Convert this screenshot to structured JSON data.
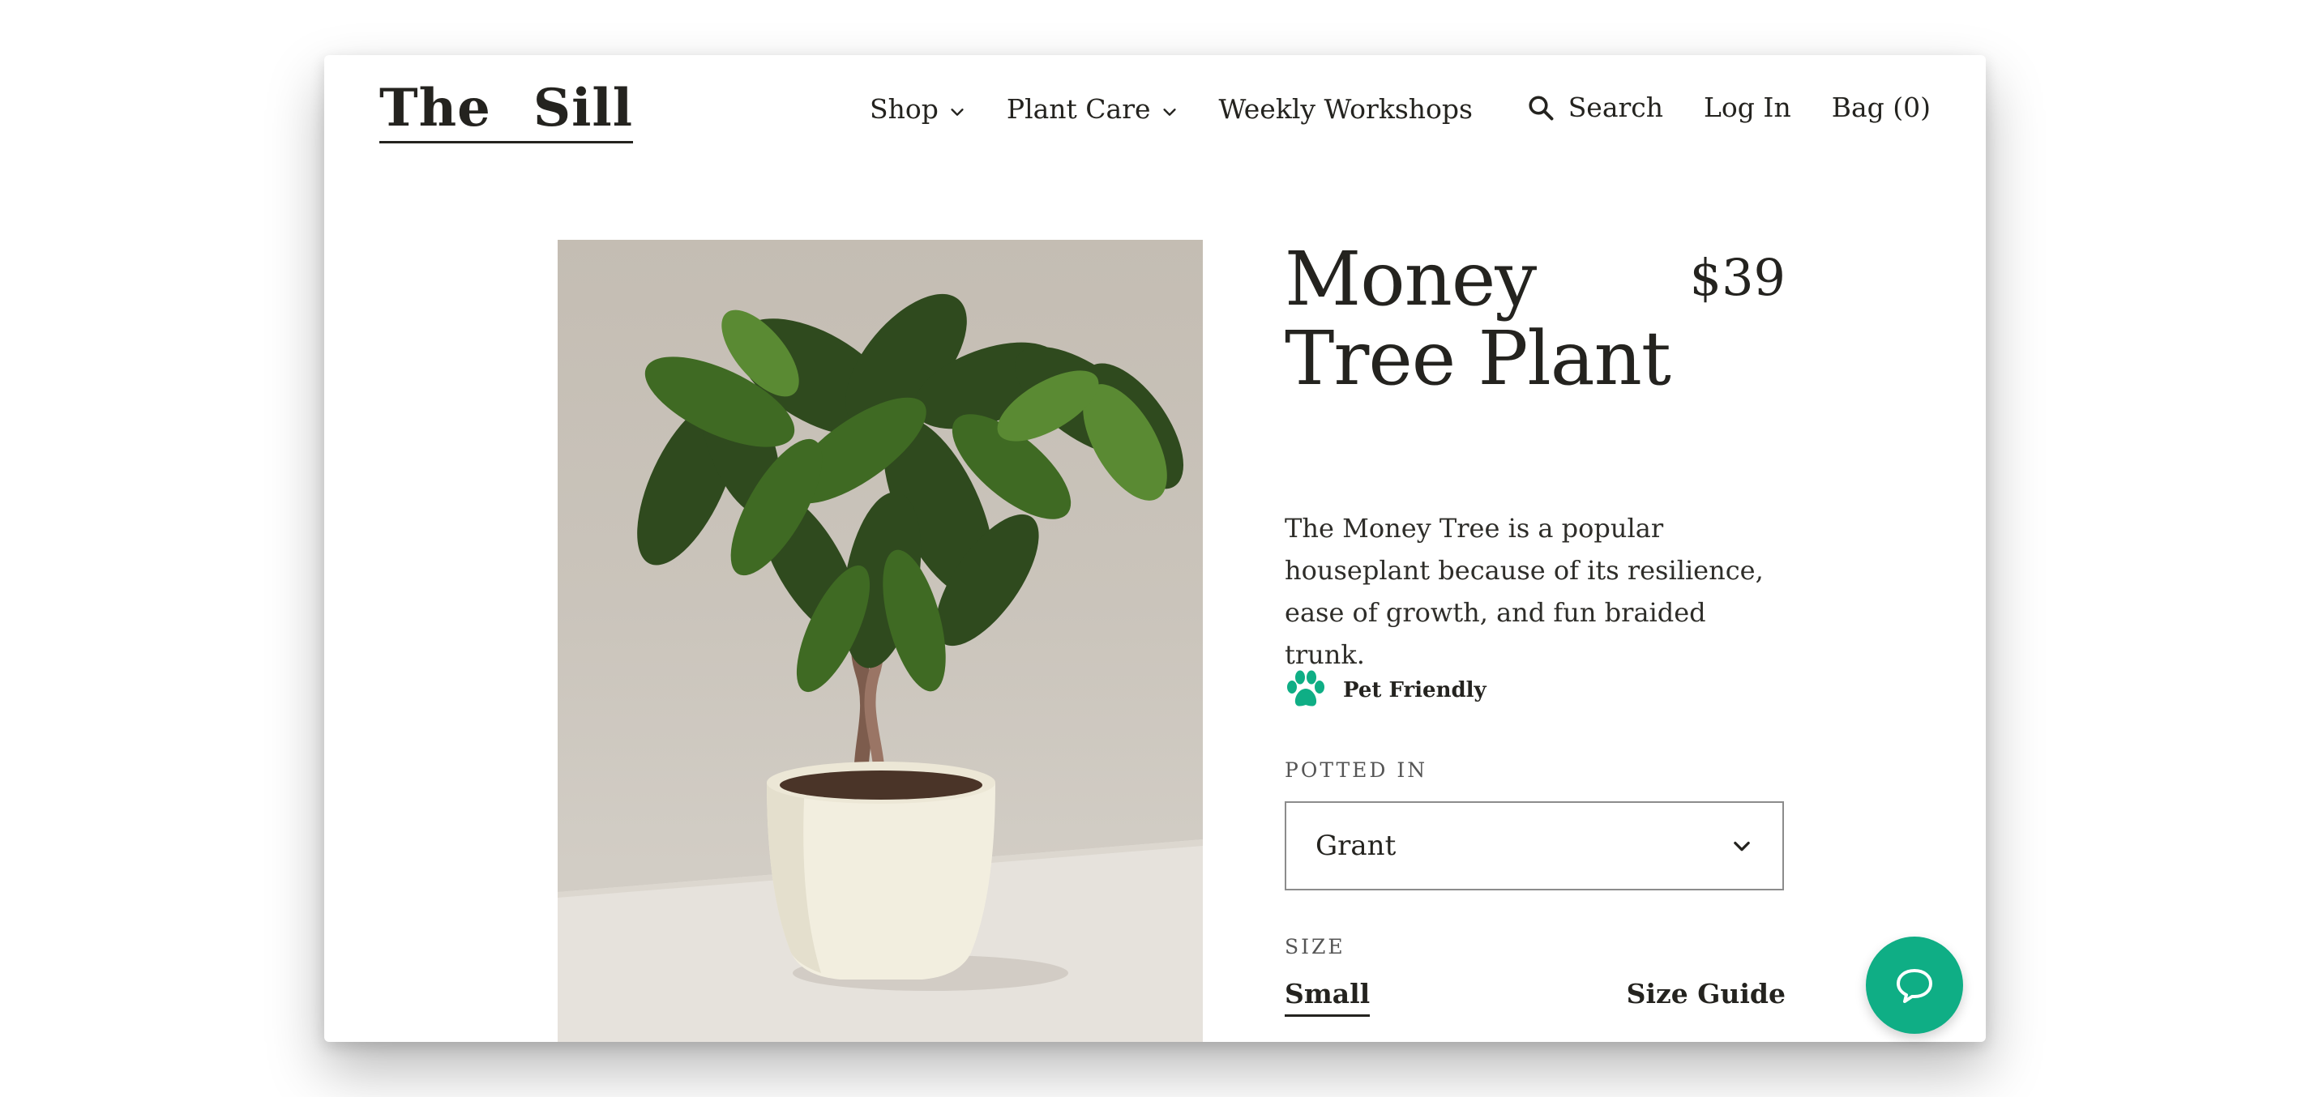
{
  "brand": {
    "logo_word1": "The",
    "logo_word2": "Sill"
  },
  "nav": {
    "items": [
      {
        "label": "Shop",
        "icon": "chevron-down-icon"
      },
      {
        "label": "Plant Care",
        "icon": "chevron-down-icon"
      },
      {
        "label": "Weekly Workshops"
      }
    ]
  },
  "utility": {
    "search_label": "Search",
    "login_label": "Log In",
    "bag_label": "Bag (0)"
  },
  "product": {
    "title": "Money Tree Plant",
    "price": "$39",
    "description": "The Money Tree is a popular houseplant because of its resilience, ease of growth, and fun braided trunk.",
    "badge_label": "Pet Friendly",
    "badge_icon": "paw-icon",
    "potted_label": "POTTED IN",
    "potted_value": "Grant",
    "size_label": "SIZE",
    "size_value": "Small",
    "size_guide_label": "Size Guide"
  },
  "colors": {
    "accent": "#0fae85",
    "text": "#24231f"
  },
  "chat": {
    "icon": "chat-bubble-icon"
  }
}
